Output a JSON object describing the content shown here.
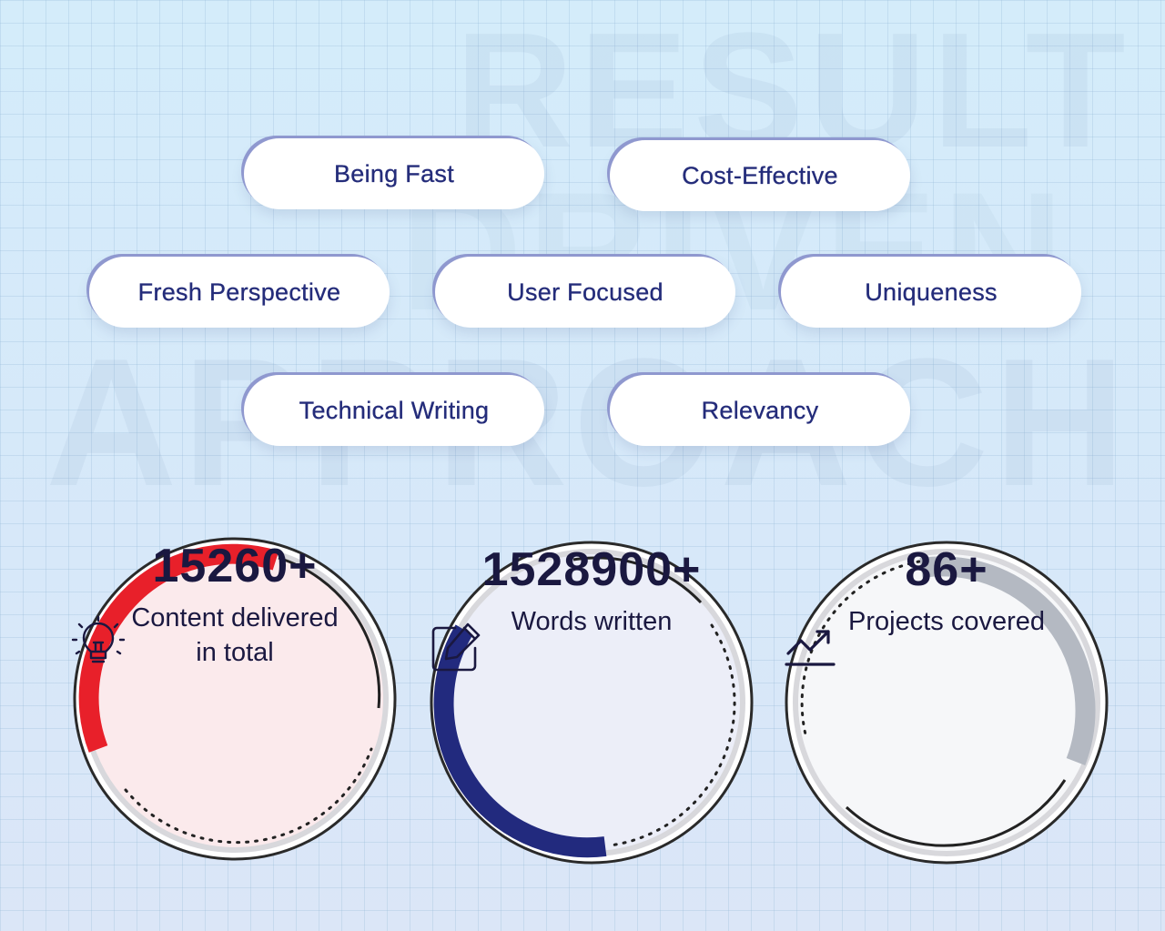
{
  "background": {
    "watermark_lines": [
      "RESULT",
      "DRIVEN",
      "APPROACH"
    ]
  },
  "features": [
    "Being Fast",
    "Cost-Effective",
    "Fresh Perspective",
    "User Focused",
    "Uniqueness",
    "Technical Writing",
    "Relevancy"
  ],
  "stats": [
    {
      "value": "15260+",
      "label_line1": "Content delivered",
      "label_line2": "in total",
      "icon": "lightbulb-icon",
      "accent": "#e8202a",
      "fill": "#fbeaec"
    },
    {
      "value": "1528900+",
      "label_line1": "Words written",
      "label_line2": "",
      "icon": "edit-icon",
      "accent": "#222a7e",
      "fill": "#eceef8"
    },
    {
      "value": "86+",
      "label_line1": "Projects covered",
      "label_line2": "",
      "icon": "trending-up-icon",
      "accent": "#b4b9c2",
      "fill": "#f6f7f9"
    }
  ]
}
